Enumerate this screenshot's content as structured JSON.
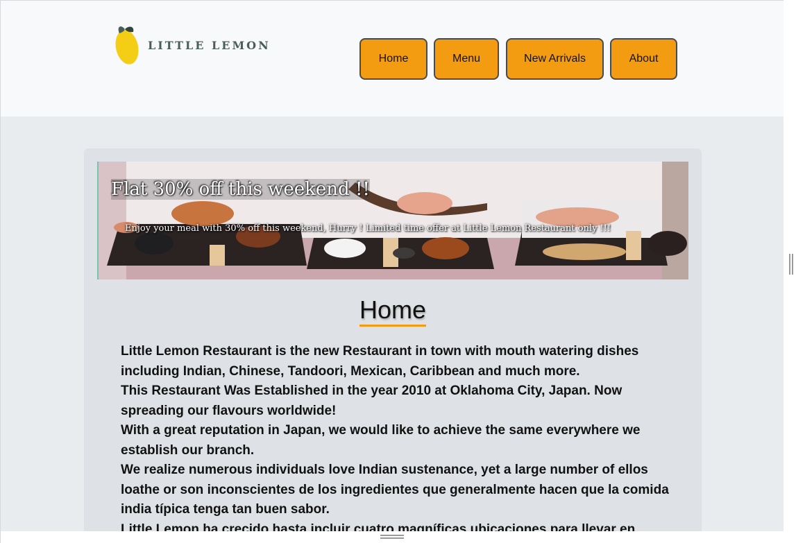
{
  "brand": {
    "logo_text": "LITTLE LEMON",
    "accent_color": "#f39c12",
    "text_color": "#495e57"
  },
  "nav": {
    "items": [
      {
        "label": "Home"
      },
      {
        "label": "Menu"
      },
      {
        "label": "New Arrivals"
      },
      {
        "label": "About"
      }
    ]
  },
  "banner": {
    "title": "Flat 30% off this weekend !!",
    "subtitle": "Enjoy your meal with 30% off this weekend, Hurry ! Limited time offer at Little Lemon Restaurant only !!!"
  },
  "main": {
    "heading": "Home",
    "paragraphs": [
      "Little Lemon Restaurant is the new Restaurant in town with mouth watering dishes including Indian, Chinese, Tandoori, Mexican, Caribbean and much more.",
      "This Restaurant Was Established in the year 2010 at Oklahoma City, Japan. Now spreading our flavours worldwide!",
      "With a great reputation in Japan, we would like to achieve the same everywhere we establish our branch.",
      "We realize numerous individuals love Indian sustenance, yet a large number of ellos loathe or son inconscientes de los ingredientes que generalmente hacen que la comida india típica tenga tan buen sabor.",
      "Little Lemon ha crecido hasta incluir cuatro magníficas ubicaciones para llevar en"
    ]
  }
}
